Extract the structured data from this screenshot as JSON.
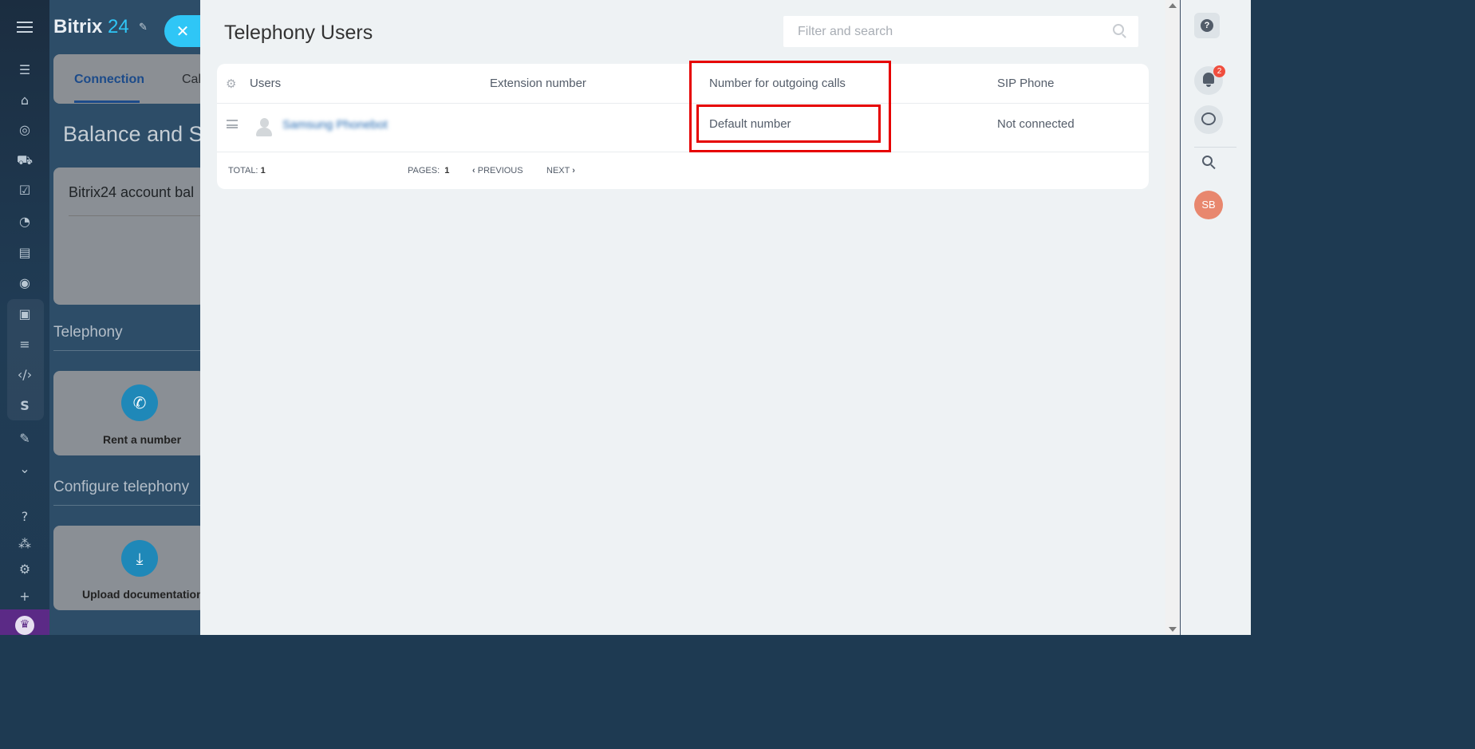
{
  "app": {
    "logo_main": "Bitrix",
    "logo_accent": "24"
  },
  "leftnav": {
    "icons": [
      "filter-icon",
      "bank-icon",
      "target-icon",
      "cart-icon",
      "tasks-icon",
      "pie-icon",
      "contact-card-icon",
      "robot-icon",
      "box-icon",
      "marketing-icon",
      "code-icon",
      "s-icon",
      "sign-icon",
      "more-icon",
      "help-icon",
      "sitemap-icon",
      "settings-icon",
      "plus-icon"
    ],
    "s_label": "S"
  },
  "background": {
    "tab_connection": "Connection",
    "tab_calls": "Cal",
    "heading": "Balance and St",
    "balance_title": "Bitrix24 account bal",
    "telephony_section": "Telephony",
    "rent_label": "Rent a number",
    "configure_section": "Configure telephony",
    "upload_label": "Upload documentation"
  },
  "panel": {
    "title": "Telephony Users",
    "search_placeholder": "Filter and search",
    "columns": {
      "users": "Users",
      "extension": "Extension number",
      "outgoing": "Number for outgoing calls",
      "sip": "SIP Phone"
    },
    "rows": [
      {
        "user": "Samsung Phonebot",
        "extension": "",
        "outgoing": "Default number",
        "sip": "Not connected"
      }
    ],
    "footer": {
      "total_label": "TOTAL:",
      "total_value": "1",
      "pages_label": "PAGES:",
      "pages_value": "1",
      "previous": "PREVIOUS",
      "next": "NEXT"
    }
  },
  "rightbar": {
    "notifications_count": "2",
    "avatar_initials": "SB"
  },
  "colors": {
    "accent": "#2fc6f6",
    "highlight": "#e60000",
    "avatar": "#e8876e"
  }
}
